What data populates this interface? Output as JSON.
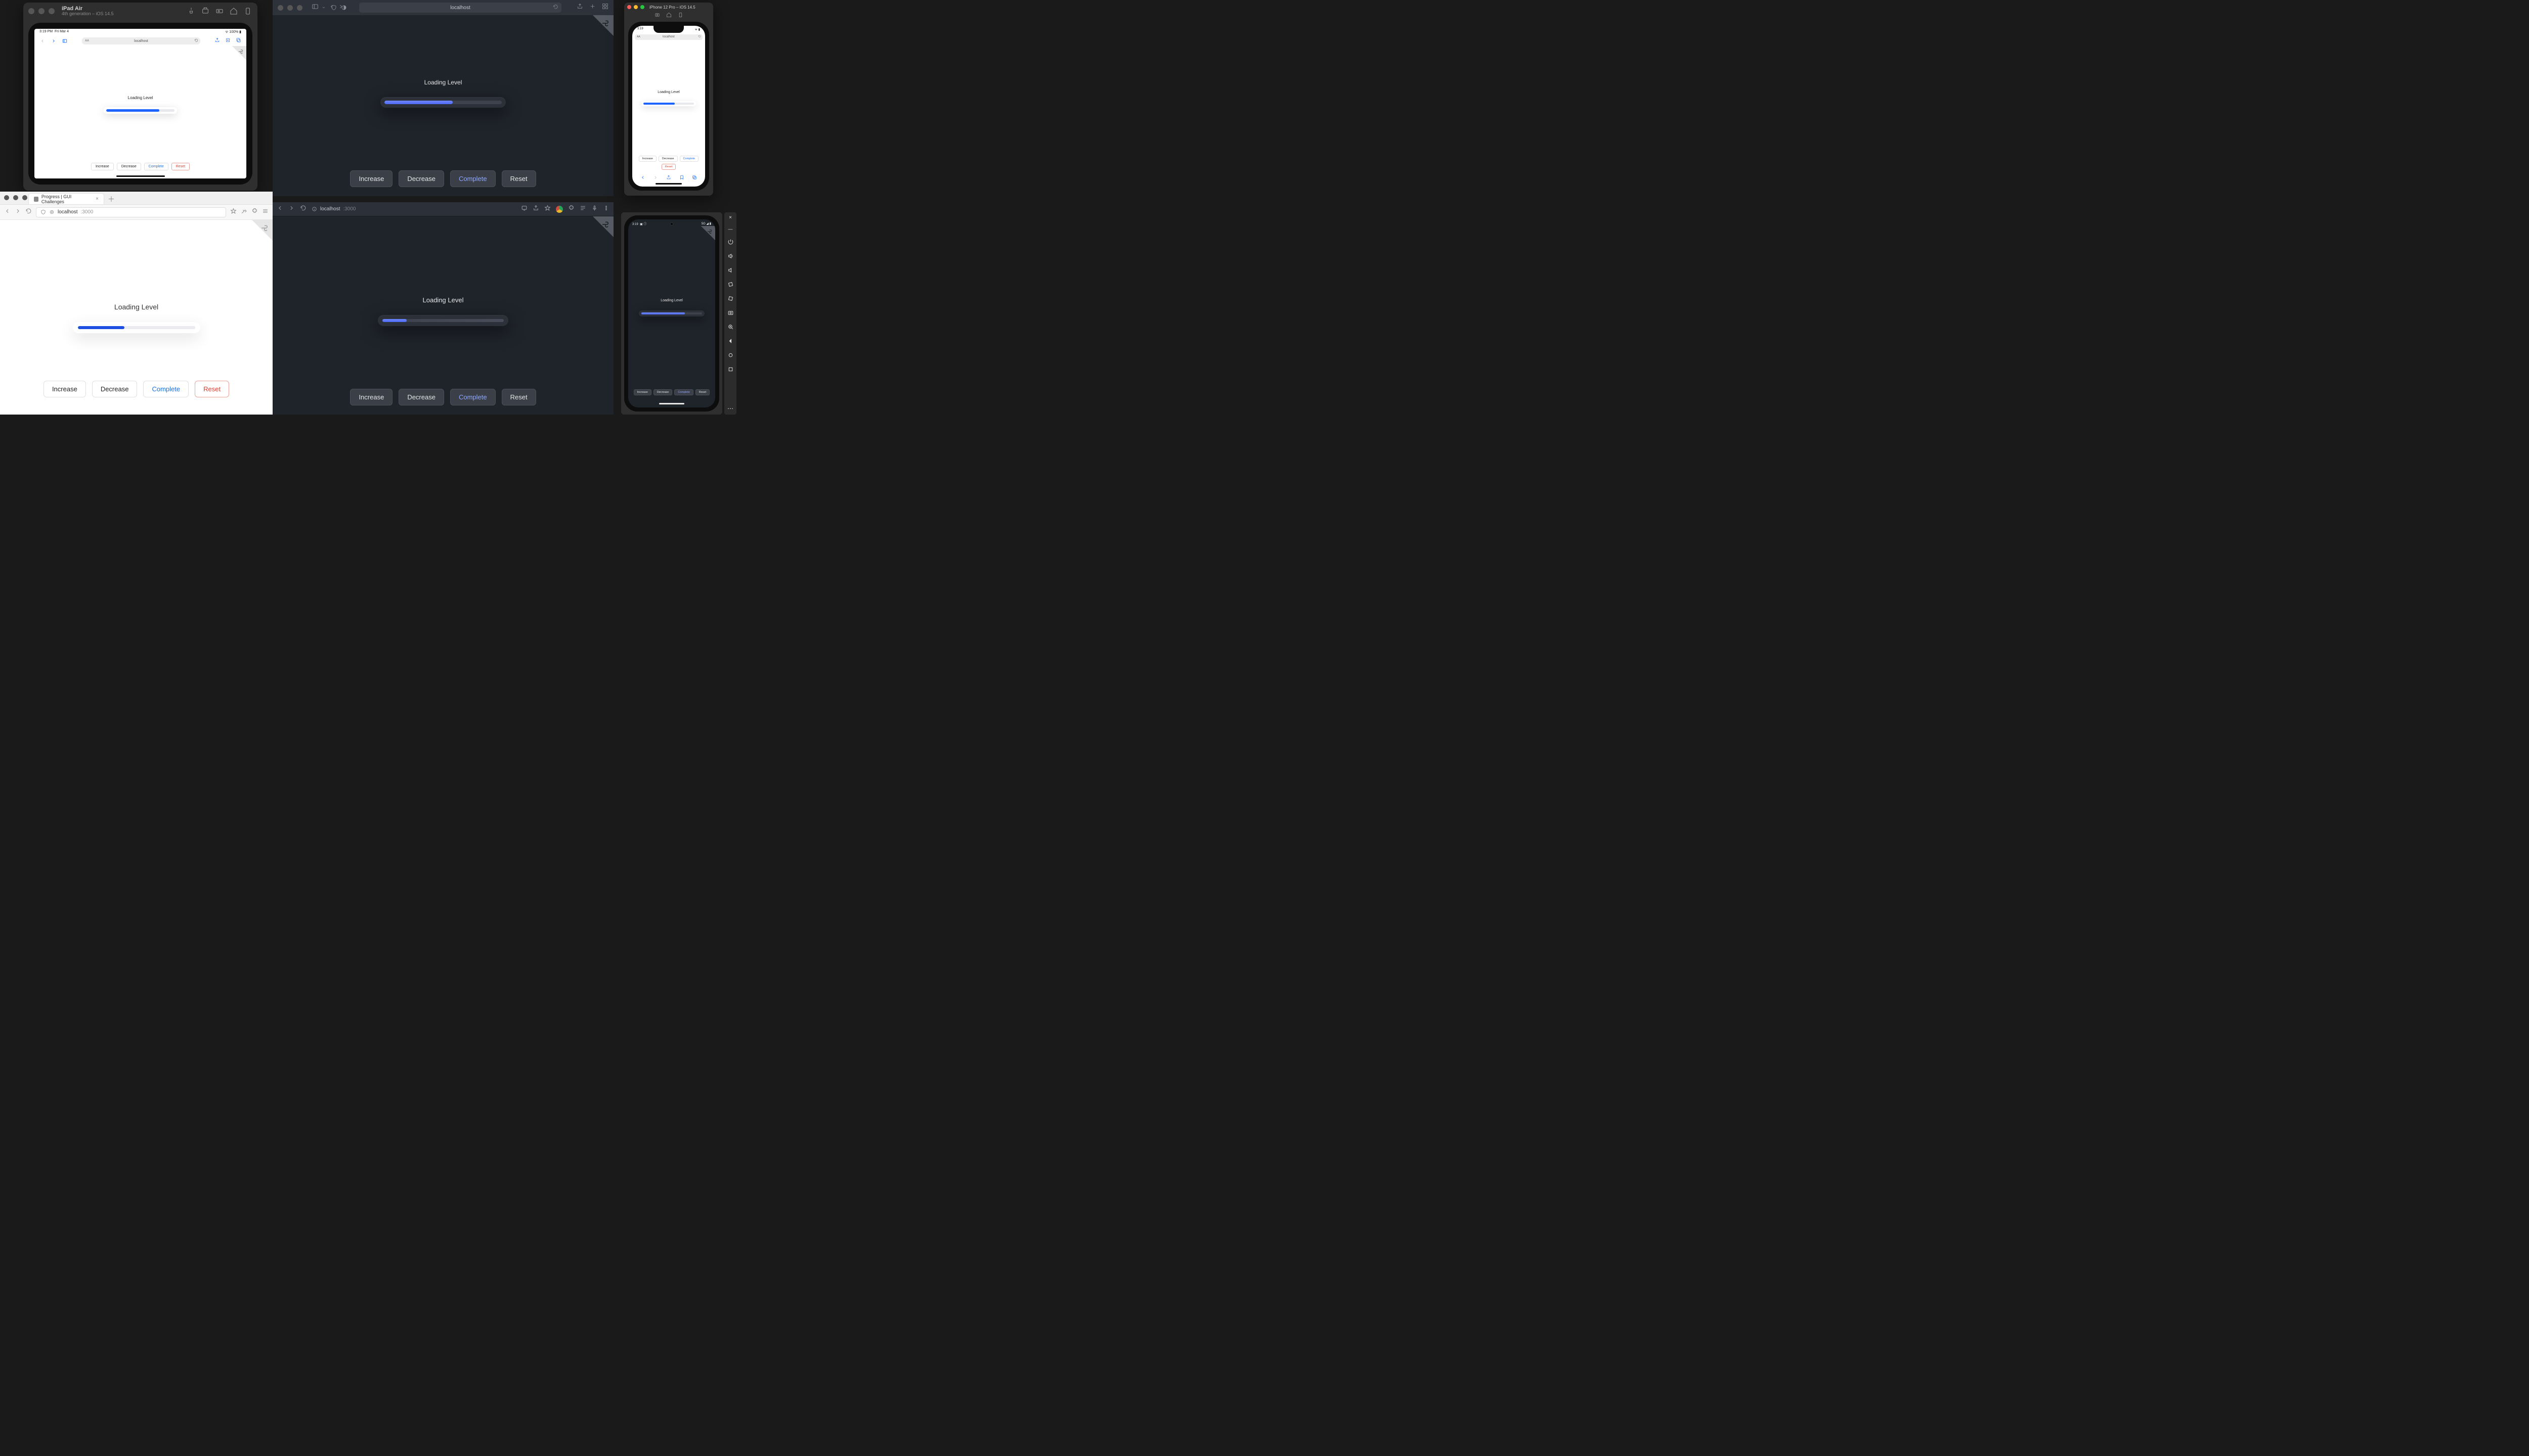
{
  "common": {
    "label": "Loading Level",
    "buttons": {
      "increase": "Increase",
      "decrease": "Decrease",
      "complete": "Complete",
      "reset": "Reset"
    }
  },
  "ipad": {
    "window_title": "iPad Air",
    "window_subtitle": "4th generation – iOS 14.5",
    "status_time": "3:19 PM",
    "status_date": "Fri Mar 4",
    "status_batt": "100%",
    "url": "localhost",
    "aa": "AA"
  },
  "safari": {
    "url": "localhost"
  },
  "firefox": {
    "tab_title": "Progress | GUI Challenges",
    "host": "localhost",
    "port": ":3000"
  },
  "chrome": {
    "host": "localhost",
    "port": ":3000"
  },
  "iphone": {
    "window_title": "iPhone 12 Pro – iOS 14.5",
    "status_time": "3:19",
    "url": "localhost",
    "aa": "AA"
  },
  "android": {
    "status_time": "3:19",
    "status_debug": "▣ ⓘ",
    "status_net": "5G ◢ ▮"
  }
}
